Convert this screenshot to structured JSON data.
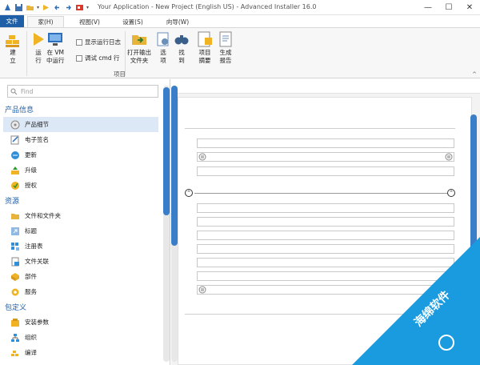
{
  "window": {
    "title": "Your Application - New Project (English US) - Advanced Installer 16.0",
    "minimize": "—",
    "maximize": "☐",
    "close": "✕"
  },
  "tabs": [
    {
      "label": "文件"
    },
    {
      "label": "家(H)"
    },
    {
      "label": "视图(V)"
    },
    {
      "label": "设置(S)"
    },
    {
      "label": "向导(W)"
    }
  ],
  "ribbon": {
    "build": "建\n立",
    "run": "运\n行",
    "run_in_vm": "在 VM\n中运行",
    "show_run_log": "显示运行日志",
    "debug_cmd": "调试 cmd 行",
    "open_output": "打开输出\n文件夹",
    "options": "选\n项",
    "find": "找\n到",
    "project_summary": "项目\n摘要",
    "generate_report": "生成\n报告",
    "group_label": "项目",
    "collapse": "^"
  },
  "sidebar": {
    "search_placeholder": "Find",
    "categories": [
      {
        "label": "产品信息"
      },
      {
        "label": "资源"
      },
      {
        "label": "包定义"
      }
    ],
    "items": [
      {
        "label": "产品细节"
      },
      {
        "label": "电子签名"
      },
      {
        "label": "更新"
      },
      {
        "label": "升级"
      },
      {
        "label": "授权"
      },
      {
        "label": "文件和文件夹"
      },
      {
        "label": "标题"
      },
      {
        "label": "注册表"
      },
      {
        "label": "文件关联"
      },
      {
        "label": "部件"
      },
      {
        "label": "服务"
      },
      {
        "label": "安装参数"
      },
      {
        "label": "组织"
      },
      {
        "label": "编译"
      }
    ]
  },
  "watermark": {
    "text": "海绵软件"
  },
  "colors": {
    "accent": "#1e5fa8",
    "scroll": "#3a7dc9",
    "watermark": "#1a9be0"
  }
}
